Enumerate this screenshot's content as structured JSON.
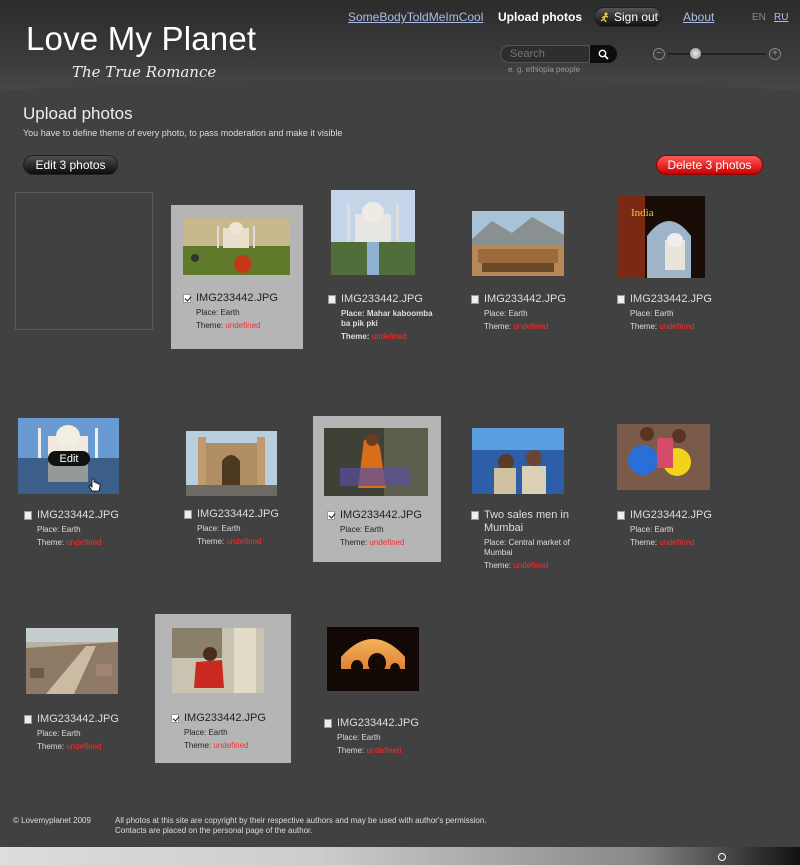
{
  "header": {
    "logo": "Love My Planet",
    "tagline": "The True Romance",
    "nav": {
      "user": "SomeBodyToldMeImCool",
      "upload": "Upload photos",
      "signout": "Sign out",
      "about": "About"
    },
    "lang": {
      "en": "EN",
      "ru": "RU"
    },
    "search": {
      "placeholder": "Search",
      "hint": "e. g. ethiopia people"
    }
  },
  "main": {
    "title": "Upload photos",
    "subtitle": "You have to define theme of every photo, to pass moderation and make it visible",
    "edit_button": "Edit 3 photos",
    "delete_button": "Delete 3 photos",
    "place_label": "Place:",
    "theme_label": "Theme:",
    "edit_overlay": "Edit",
    "photos": [
      {
        "name": "IMG233442.JPG",
        "place": "Earth",
        "theme": "undefined",
        "checked": true
      },
      {
        "name": "IMG233442.JPG",
        "place": "Mahar kaboomba ba pik pki",
        "theme": "undefined",
        "checked": false
      },
      {
        "name": "IMG233442.JPG",
        "place": "Earth",
        "theme": "undefined",
        "checked": false
      },
      {
        "name": "IMG233442.JPG",
        "place": "Earth",
        "theme": "undefined",
        "checked": false
      },
      {
        "name": "IMG233442.JPG",
        "place": "Earth",
        "theme": "undefined",
        "checked": false
      },
      {
        "name": "IMG233442.JPG",
        "place": "Earth",
        "theme": "undefined",
        "checked": false
      },
      {
        "name": "IMG233442.JPG",
        "place": "Earth",
        "theme": "undefined",
        "checked": true
      },
      {
        "name": "Two sales men in Mumbai",
        "place": "Central market of Mumbai",
        "theme": "undefined",
        "checked": false
      },
      {
        "name": "IMG233442.JPG",
        "place": "Earth",
        "theme": "undefined",
        "checked": false
      },
      {
        "name": "IMG233442.JPG",
        "place": "Earth",
        "theme": "undefined",
        "checked": false
      },
      {
        "name": "IMG233442.JPG",
        "place": "Earth",
        "theme": "undefined",
        "checked": true
      },
      {
        "name": "IMG233442.JPG",
        "place": "Earth",
        "theme": "undefined",
        "checked": false
      }
    ],
    "thumb_titles": {
      "india": "India"
    }
  },
  "footer": {
    "copyright": "© Lovemyplanet 2009",
    "notice_line1": "All photos at this site are copyright by their respective authors and may be used with author's permission.",
    "notice_line2": "Contacts are placed on the personal page of the author."
  },
  "colors": {
    "accent_red": "#e00000",
    "link": "#a9bde6",
    "undefined": "#ff2a2a"
  }
}
